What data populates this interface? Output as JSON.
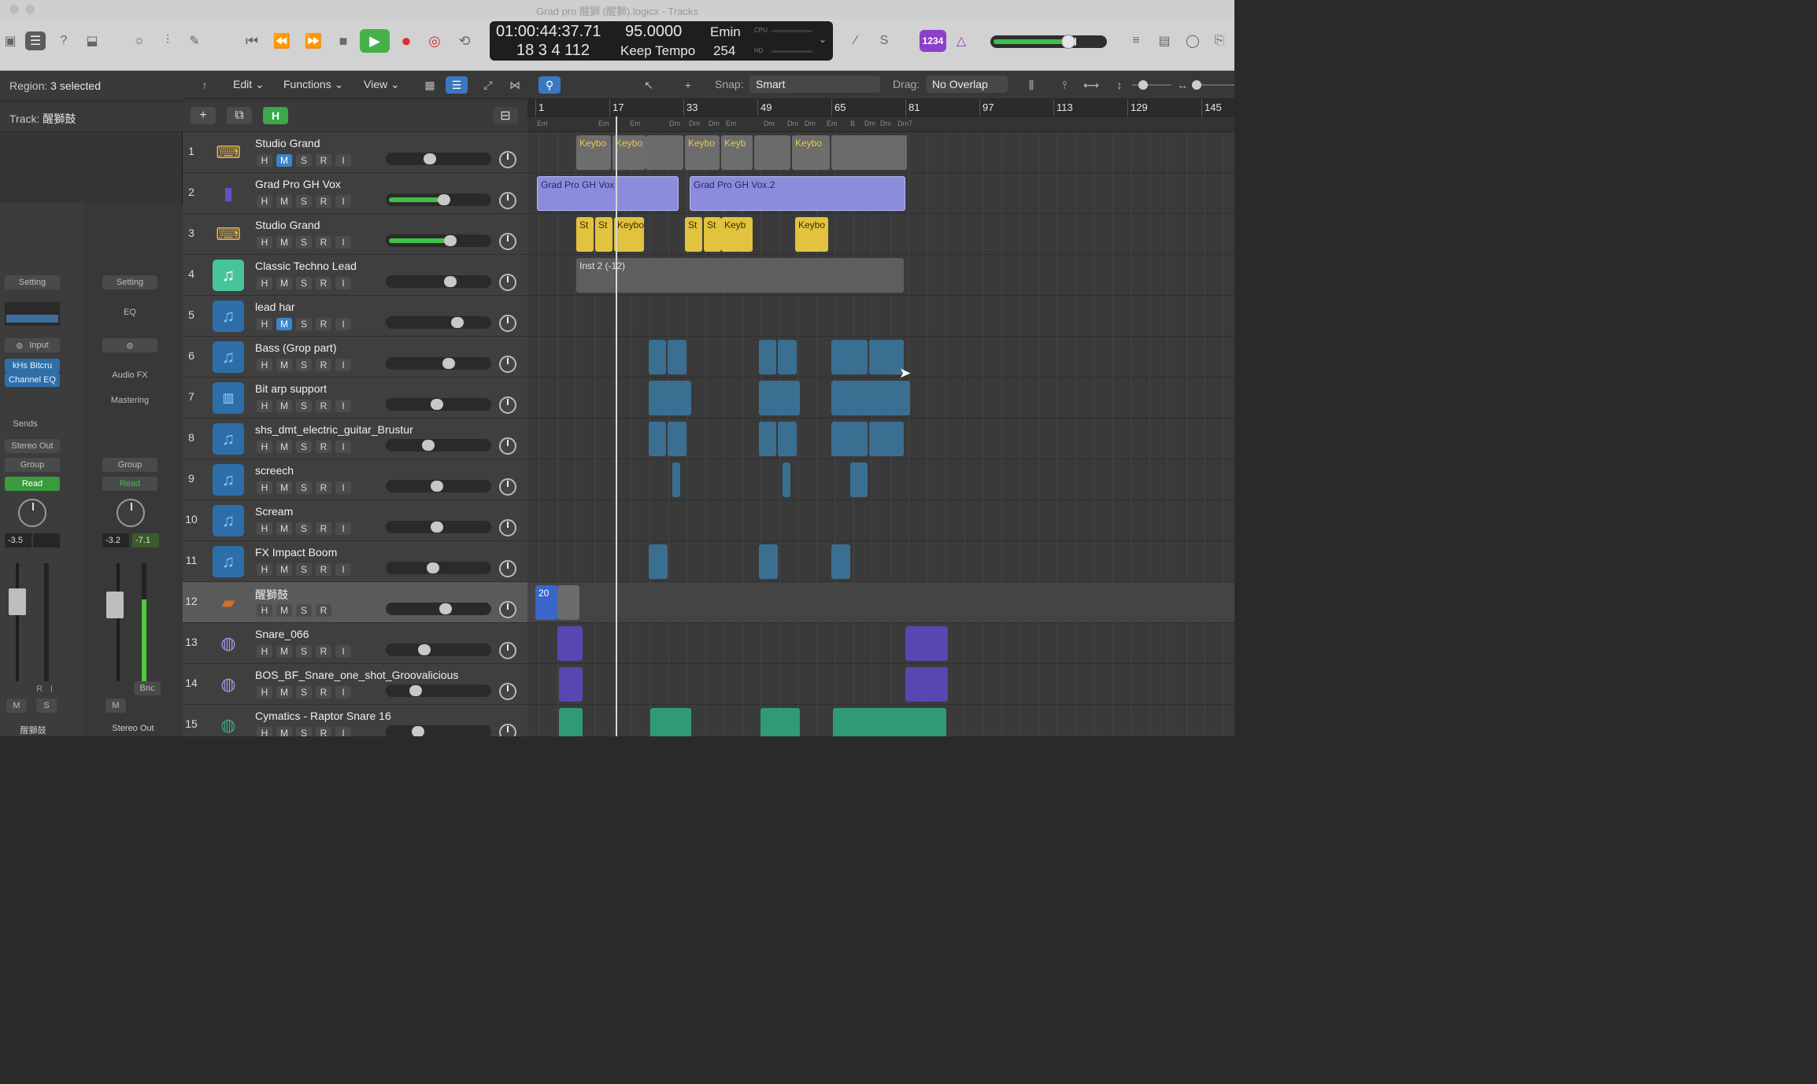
{
  "window": {
    "title": "Grad pro 醒獅 (醒獅).logicx - Tracks"
  },
  "lcd": {
    "time": "01:00:44:37.71",
    "tempo": "95.0000",
    "key": "Emin",
    "bars": "18  3  4  112",
    "tempo_mode": "Keep Tempo",
    "sig": "254",
    "cpu_label": "CPU",
    "hd_label": "HD"
  },
  "control": {
    "badge": "1234"
  },
  "inspector": {
    "region_label": "Region:",
    "region_value": "3 selected",
    "track_label": "Track:",
    "track_value": "醒獅鼓",
    "strip1": {
      "setting": "Setting",
      "input": "Input",
      "plugin1": "kHs Bitcru",
      "plugin2": "Channel EQ",
      "sends": "Sends",
      "output": "Stereo Out",
      "group": "Group",
      "auto": "Read",
      "pan_val": "-3.5",
      "mute": "M",
      "solo": "S",
      "name": "醒獅鼓",
      "r": "R",
      "i": "I"
    },
    "strip2": {
      "setting": "Setting",
      "eq": "EQ",
      "audiofx": "Audio FX",
      "mastering": "Mastering",
      "group": "Group",
      "auto": "Read",
      "val1": "-3.2",
      "val2": "-7.1",
      "mute": "M",
      "bnc": "Bnc",
      "name": "Stereo Out"
    }
  },
  "toolbar": {
    "edit": "Edit",
    "functions": "Functions",
    "view": "View",
    "snap_label": "Snap:",
    "snap_value": "Smart",
    "drag_label": "Drag:",
    "drag_value": "No Overlap"
  },
  "header": {
    "add": "+",
    "h": "H"
  },
  "ruler": {
    "bars": [
      "1",
      "17",
      "33",
      "49",
      "65",
      "81",
      "97",
      "113",
      "129",
      "145"
    ]
  },
  "chords": [
    "Em",
    "Em",
    "Em",
    "Dm",
    "Dm",
    "Dm",
    "Em",
    "Dm",
    "Dm",
    "Dm",
    "Em",
    "B",
    "Dm",
    "Dm",
    "Dm7"
  ],
  "tracks": [
    {
      "num": "1",
      "name": "Studio Grand",
      "icon": "piano",
      "vol": 0.4,
      "fill": false,
      "mute": true,
      "btns": [
        "H",
        "M",
        "S",
        "R",
        "I"
      ]
    },
    {
      "num": "2",
      "name": "Grad Pro GH Vox",
      "icon": "mic",
      "vol": 0.56,
      "fill": true,
      "mute": false,
      "btns": [
        "H",
        "M",
        "S",
        "R",
        "I"
      ]
    },
    {
      "num": "3",
      "name": "Studio Grand",
      "icon": "piano",
      "vol": 0.64,
      "fill": true,
      "mute": false,
      "btns": [
        "H",
        "M",
        "S",
        "R",
        "I"
      ]
    },
    {
      "num": "4",
      "name": "Classic Techno Lead",
      "icon": "green",
      "vol": 0.64,
      "fill": false,
      "mute": false,
      "btns": [
        "H",
        "M",
        "S",
        "R",
        "I"
      ]
    },
    {
      "num": "5",
      "name": "lead har",
      "icon": "inst",
      "vol": 0.72,
      "fill": false,
      "mute": true,
      "btns": [
        "H",
        "M",
        "S",
        "R",
        "I"
      ]
    },
    {
      "num": "6",
      "name": "Bass (Grop part)",
      "icon": "inst",
      "vol": 0.62,
      "fill": false,
      "mute": false,
      "btns": [
        "H",
        "M",
        "S",
        "R",
        "I"
      ]
    },
    {
      "num": "7",
      "name": "Bit arp support",
      "icon": "wave",
      "vol": 0.48,
      "fill": false,
      "mute": false,
      "btns": [
        "H",
        "M",
        "S",
        "R",
        "I"
      ]
    },
    {
      "num": "8",
      "name": "shs_dmt_electric_guitar_Brustur",
      "icon": "inst",
      "vol": 0.38,
      "fill": false,
      "mute": false,
      "btns": [
        "H",
        "M",
        "S",
        "R",
        "I"
      ]
    },
    {
      "num": "9",
      "name": "screech",
      "icon": "inst",
      "vol": 0.48,
      "fill": false,
      "mute": false,
      "btns": [
        "H",
        "M",
        "S",
        "R",
        "I"
      ]
    },
    {
      "num": "10",
      "name": "Scream",
      "icon": "inst",
      "vol": 0.48,
      "fill": false,
      "mute": false,
      "btns": [
        "H",
        "M",
        "S",
        "R",
        "I"
      ]
    },
    {
      "num": "11",
      "name": "FX Impact Boom",
      "icon": "inst",
      "vol": 0.44,
      "fill": false,
      "mute": false,
      "btns": [
        "H",
        "M",
        "S",
        "R",
        "I"
      ]
    },
    {
      "num": "12",
      "name": "醒獅鼓",
      "icon": "pot",
      "vol": 0.58,
      "fill": false,
      "mute": false,
      "btns": [
        "H",
        "M",
        "S",
        "R"
      ]
    },
    {
      "num": "13",
      "name": "Snare_066",
      "icon": "drum",
      "vol": 0.34,
      "fill": false,
      "mute": false,
      "btns": [
        "H",
        "M",
        "S",
        "R",
        "I"
      ]
    },
    {
      "num": "14",
      "name": "BOS_BF_Snare_one_shot_Groovalicious",
      "icon": "drum",
      "vol": 0.24,
      "fill": false,
      "mute": false,
      "btns": [
        "H",
        "M",
        "S",
        "R",
        "I"
      ]
    },
    {
      "num": "15",
      "name": "Cymatics - Raptor Snare 16",
      "icon": "drum2",
      "vol": 0.26,
      "fill": false,
      "mute": false,
      "btns": [
        "H",
        "M",
        "S",
        "R",
        "I"
      ]
    }
  ],
  "regions": {
    "t1": [
      "Keybo",
      "Keybo",
      "Keybo",
      "Keyb",
      "Keybo"
    ],
    "t2": [
      "Grad Pro GH Vox",
      "Grad Pro GH Vox.2"
    ],
    "t3": [
      "St",
      "St",
      "Keybo",
      "St",
      "St",
      "Keyb",
      "Keybo"
    ],
    "t4": "Inst 2 (-12)",
    "t12": "20"
  },
  "colors": {
    "accent": "#3b78c2",
    "play": "#46b04a",
    "record": "#d8322f",
    "audio": "#8c8cdc",
    "yellow": "#e2c23e"
  }
}
